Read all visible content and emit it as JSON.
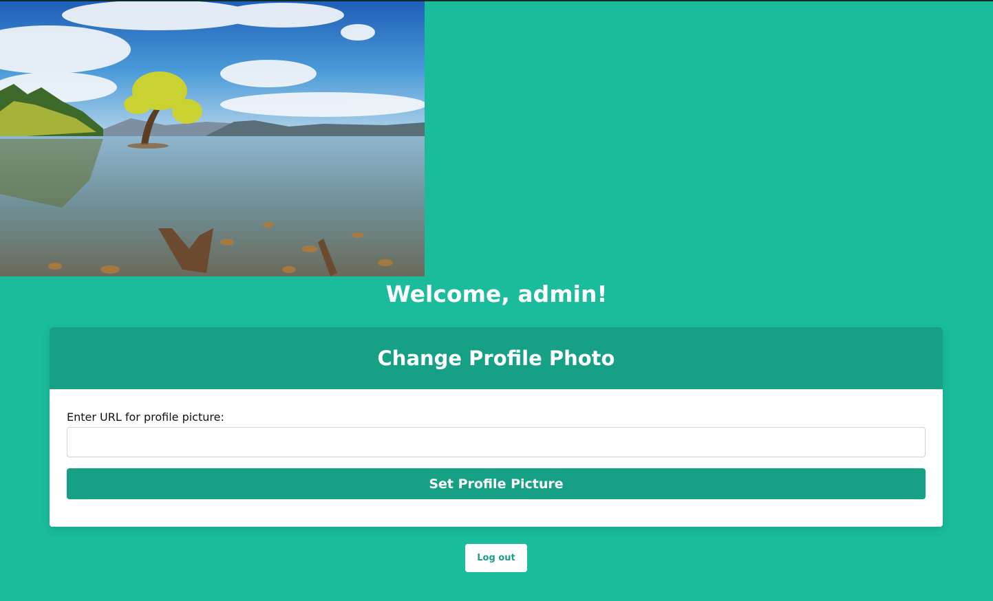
{
  "colors": {
    "page_background": "#1abc9c",
    "accent": "#16a085",
    "card_background": "#ffffff",
    "text_white": "#ffffff"
  },
  "hero_image": {
    "subject": "landscape-photo"
  },
  "welcome": {
    "text": "Welcome, admin!"
  },
  "profile_card": {
    "title": "Change Profile Photo",
    "url_label": "Enter URL for profile picture:",
    "url_value": "",
    "url_placeholder": "",
    "submit_label": "Set Profile Picture"
  },
  "logout": {
    "label": "Log out"
  }
}
